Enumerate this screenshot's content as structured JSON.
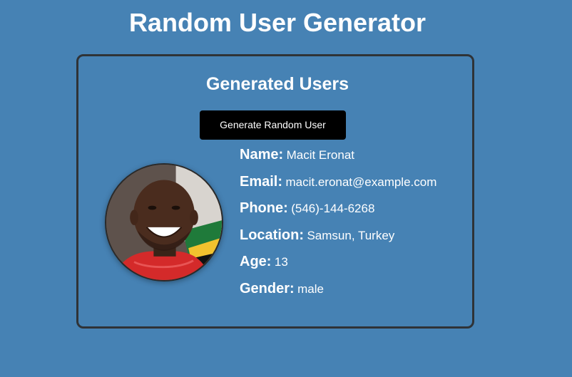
{
  "header": {
    "title": "Random User Generator"
  },
  "card": {
    "title": "Generated Users",
    "button_label": "Generate Random User"
  },
  "user": {
    "avatar": "user-photo",
    "fields": [
      {
        "label": "Name:",
        "value": "Macit Eronat"
      },
      {
        "label": "Email:",
        "value": "macit.eronat@example.com"
      },
      {
        "label": "Phone:",
        "value": "(546)-144-6268"
      },
      {
        "label": "Location:",
        "value": "Samsun, Turkey"
      },
      {
        "label": "Age:",
        "value": "13"
      },
      {
        "label": "Gender:",
        "value": "male"
      }
    ]
  },
  "colors": {
    "background": "#4682b4",
    "button": "#000000",
    "border": "#2f3337",
    "text": "#ffffff"
  }
}
